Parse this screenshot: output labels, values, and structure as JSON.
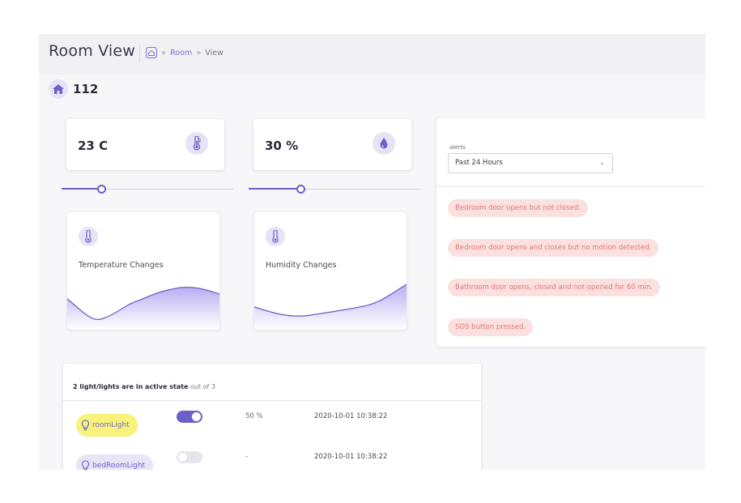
{
  "header": {
    "title": "Room View",
    "breadcrumb": [
      {
        "label": "Room"
      },
      {
        "label": "View"
      }
    ]
  },
  "room": {
    "number": "112"
  },
  "metrics": [
    {
      "value": "23 C",
      "icon": "thermometer-icon",
      "slider_fraction": 0.23
    },
    {
      "value": "30 %",
      "icon": "droplet-icon",
      "slider_fraction": 0.3
    }
  ],
  "trends": [
    {
      "label": "Temperature Changes",
      "icon": "thermometer-icon"
    },
    {
      "label": "Humidity Changes",
      "icon": "thermometer-icon"
    }
  ],
  "alerts": {
    "caption": "alerts",
    "selected_range": "Past 24 Hours",
    "items": [
      "Bedroom door opens but not closed.",
      "Bedroom door opens and closes but no motion detected.",
      "Bathroom door opens, closed and not opened for 60 min.",
      "SOS button pressed."
    ]
  },
  "lights": {
    "summary_prefix": "2 light/lights are in active state",
    "summary_suffix": "out of 3",
    "rows": [
      {
        "name": "roomLight",
        "state": "on",
        "level": "50 %",
        "time": "2020-10-01 10:38:22"
      },
      {
        "name": "bedRoomLight",
        "state": "off",
        "level": "-",
        "time": "2020-10-01 10:38:22"
      }
    ]
  },
  "colors": {
    "accent": "#6c5fc9",
    "accent_soft": "#e6e3f6",
    "alert_bg": "#fbe0e0",
    "alert_text": "#e0767a",
    "light_on": "#f6f27a"
  }
}
